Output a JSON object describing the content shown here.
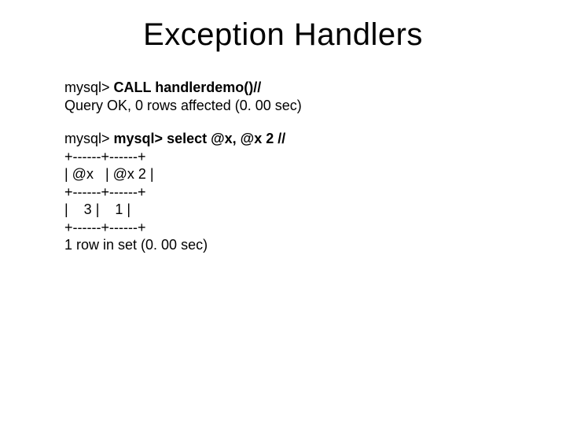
{
  "title": "Exception Handlers",
  "block1": {
    "l1_prompt": "mysql> ",
    "l1_cmd": "CALL handlerdemo()//",
    "l2": "Query OK, 0 rows affected (0. 00 sec)"
  },
  "block2": {
    "l1_prompt": "mysql> ",
    "l1_cmd": "mysql> select @x, @x 2 //",
    "l2": "+------+------+",
    "l3": "| @x   | @x 2 |",
    "l4": "+------+------+",
    "l5": "|    3 |    1 |",
    "l6": "+------+------+",
    "l7": "1 row in set (0. 00 sec)"
  }
}
